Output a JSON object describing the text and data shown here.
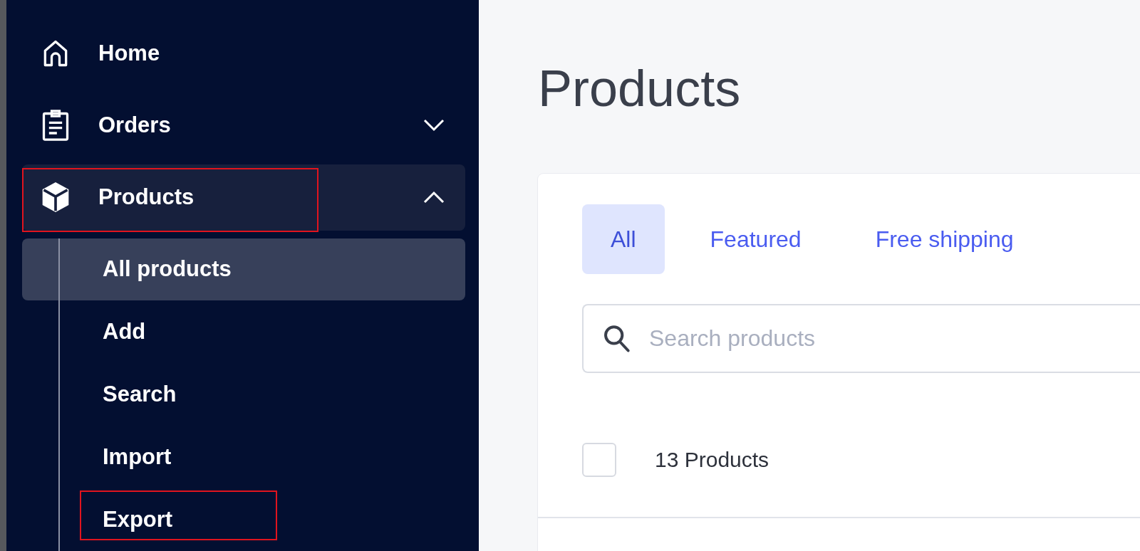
{
  "sidebar": {
    "items": [
      {
        "kind": "item",
        "label": "Home",
        "highlighted": false
      },
      {
        "kind": "group",
        "label": "Orders",
        "expanded": false,
        "highlighted": false
      },
      {
        "kind": "group",
        "label": "Products",
        "expanded": true,
        "highlighted": true,
        "children": [
          {
            "label": "All products",
            "selected": true,
            "highlighted": false
          },
          {
            "label": "Add",
            "selected": false,
            "highlighted": false
          },
          {
            "label": "Search",
            "selected": false,
            "highlighted": false
          },
          {
            "label": "Import",
            "selected": false,
            "highlighted": false
          },
          {
            "label": "Export",
            "selected": false,
            "highlighted": true
          }
        ]
      }
    ]
  },
  "page": {
    "title": "Products"
  },
  "tabs": [
    {
      "label": "All",
      "selected": true
    },
    {
      "label": "Featured",
      "selected": false
    },
    {
      "label": "Free shipping",
      "selected": false
    }
  ],
  "search": {
    "placeholder": "Search products"
  },
  "list_header": {
    "checked": false,
    "count": "13 Products"
  }
}
